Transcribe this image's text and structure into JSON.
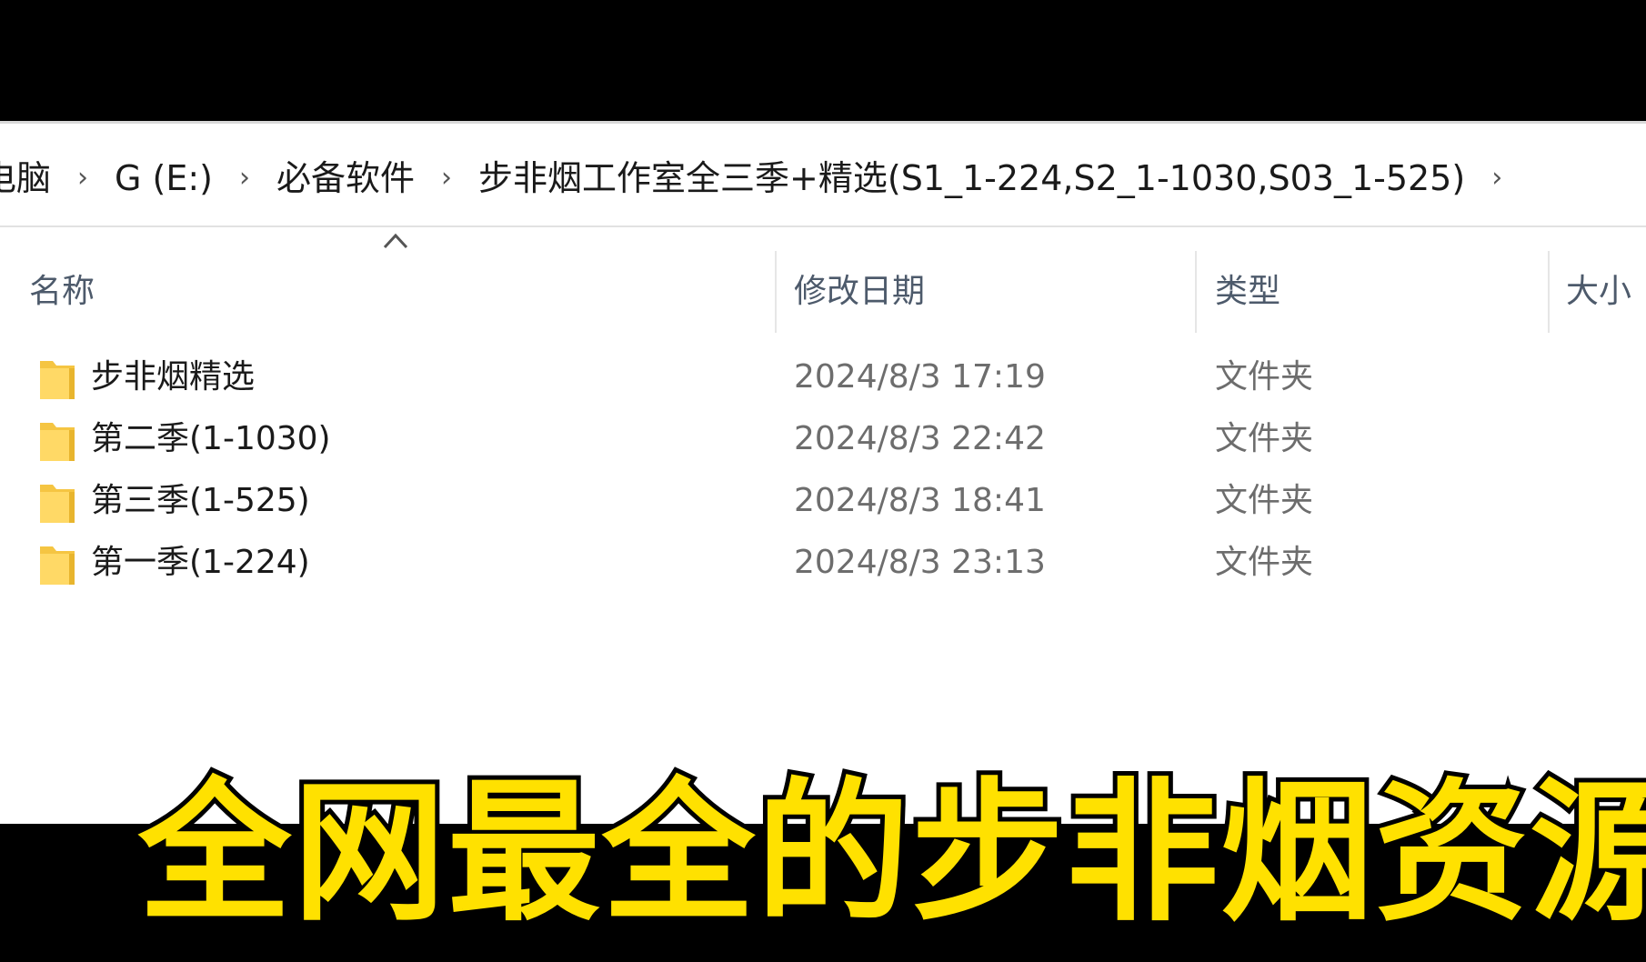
{
  "breadcrumb": [
    {
      "label": "电脑"
    },
    {
      "label": "G (E:)"
    },
    {
      "label": "必备软件"
    },
    {
      "label": "步非烟工作室全三季+精选(S1_1-224,S2_1-1030,S03_1-525)"
    }
  ],
  "columns": {
    "name": "名称",
    "date": "修改日期",
    "type": "类型",
    "size": "大小"
  },
  "files": [
    {
      "name": "步非烟精选",
      "date": "2024/8/3 17:19",
      "type": "文件夹"
    },
    {
      "name": "第二季(1-1030)",
      "date": "2024/8/3 22:42",
      "type": "文件夹"
    },
    {
      "name": "第三季(1-525)",
      "date": "2024/8/3 18:41",
      "type": "文件夹"
    },
    {
      "name": "第一季(1-224)",
      "date": "2024/8/3 23:13",
      "type": "文件夹"
    }
  ],
  "caption": "全网最全的步非烟资源",
  "colors": {
    "caption": "#ffe100",
    "folder": "#f5c542",
    "header_text": "#4d5a6b"
  }
}
